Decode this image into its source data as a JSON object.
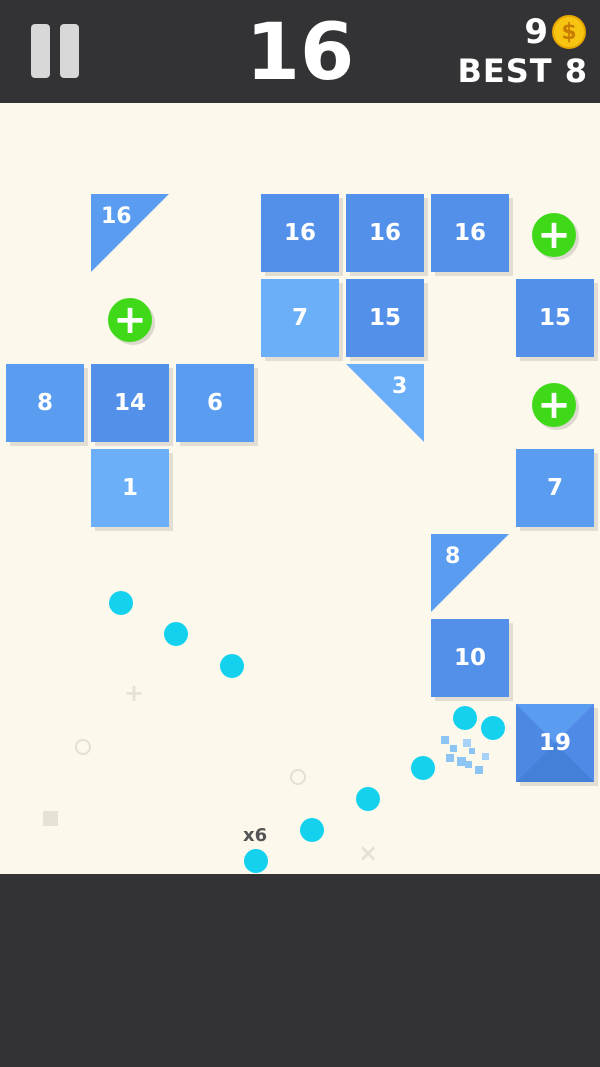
{
  "header": {
    "score": "16",
    "coins": "9",
    "coin_symbol": "$",
    "best_label": "BEST 8"
  },
  "colors": {
    "brick_dark": "#5390ea",
    "brick_mid": "#5a9cf0",
    "brick_light": "#6aaff7",
    "field": "#fcf8ec",
    "ball": "#14d2ee",
    "plus": "#3fd91a",
    "coin": "#f7c412"
  },
  "bricks": [
    {
      "label": "16",
      "shape": "tri-tl",
      "shade": "mid"
    },
    {
      "label": "16",
      "shape": "square",
      "shade": "dark"
    },
    {
      "label": "16",
      "shape": "square",
      "shade": "dark"
    },
    {
      "label": "16",
      "shape": "square",
      "shade": "dark"
    },
    {
      "label": "7",
      "shape": "square",
      "shade": "light"
    },
    {
      "label": "15",
      "shape": "square",
      "shade": "dark"
    },
    {
      "label": "15",
      "shape": "square",
      "shade": "dark"
    },
    {
      "label": "3",
      "shape": "tri-tr",
      "shade": "light"
    },
    {
      "label": "8",
      "shape": "square",
      "shade": "mid"
    },
    {
      "label": "14",
      "shape": "square",
      "shade": "dark"
    },
    {
      "label": "6",
      "shape": "square",
      "shade": "mid"
    },
    {
      "label": "1",
      "shape": "square",
      "shade": "light"
    },
    {
      "label": "7",
      "shape": "square",
      "shade": "mid"
    },
    {
      "label": "8",
      "shape": "tri-tl",
      "shade": "mid"
    },
    {
      "label": "10",
      "shape": "square",
      "shade": "dark"
    },
    {
      "label": "19",
      "shape": "hit",
      "shade": "dark"
    }
  ],
  "ball_count": "x6"
}
